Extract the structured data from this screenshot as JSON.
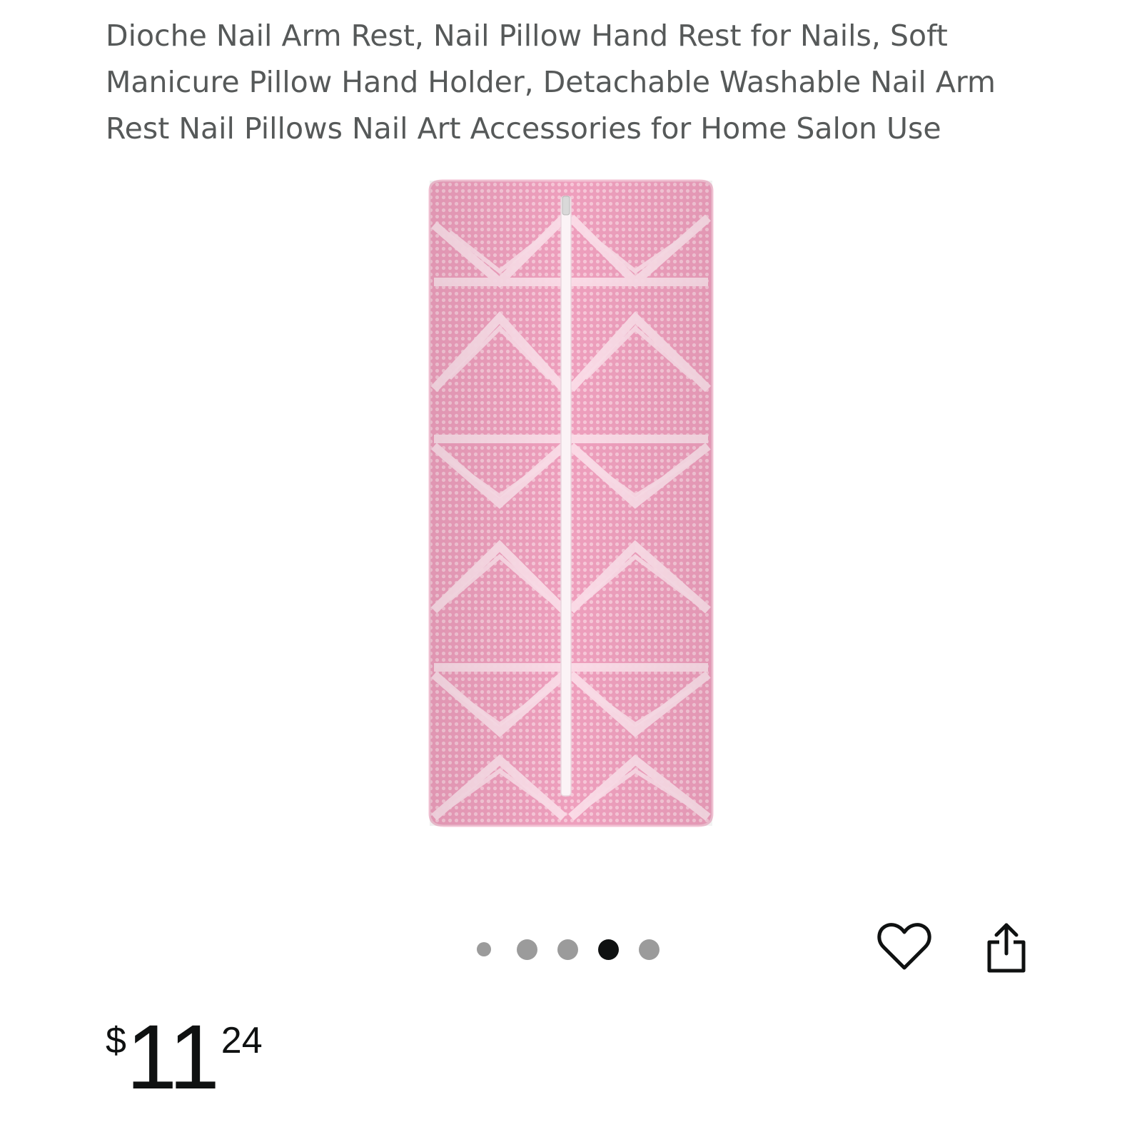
{
  "product": {
    "title": "Dioche Nail Arm Rest, Nail Pillow Hand Rest for Nails, Soft Manicure Pillow Hand Holder, Detachable Washable Nail Arm Rest Nail Pillows Nail Art Accessories for Home Salon Use"
  },
  "gallery": {
    "image_count": 5,
    "active_index": 3
  },
  "actions": {
    "wishlist_icon": "heart-outline-icon",
    "share_icon": "share-icon"
  },
  "price": {
    "symbol": "$",
    "whole": "11",
    "fraction": "24"
  },
  "colors": {
    "title_text": "#565959",
    "pillow_pink": "#f4bfd2",
    "dot_inactive": "#9b9b9b",
    "dot_active": "#0f1111"
  }
}
